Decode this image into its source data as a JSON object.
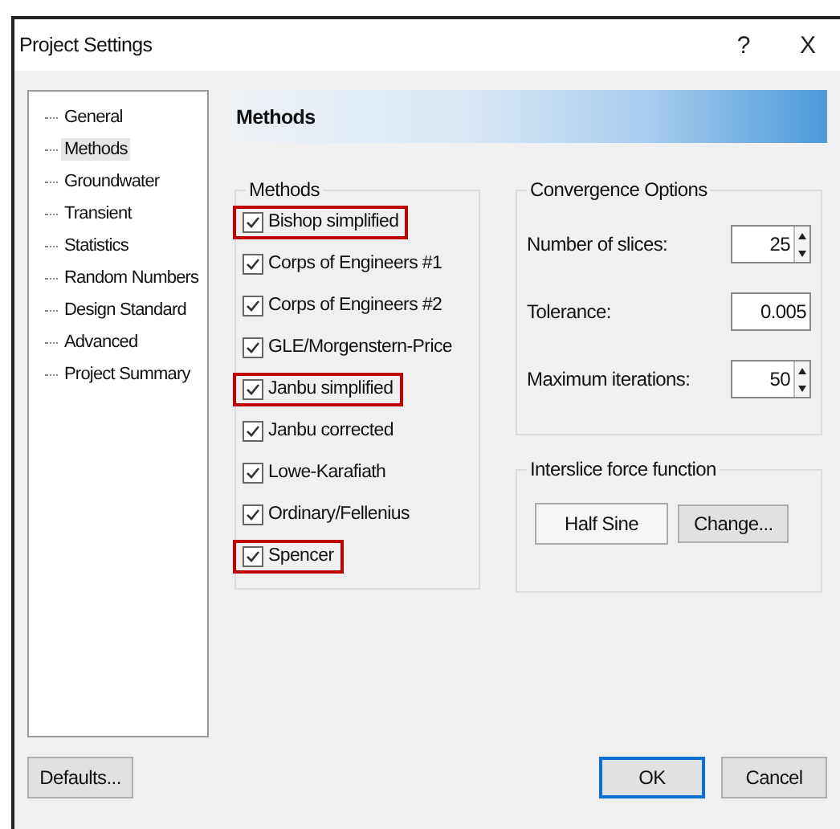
{
  "window": {
    "title": "Project Settings",
    "help": "?",
    "close": "X"
  },
  "sidebar": {
    "items": [
      {
        "label": "General",
        "selected": false
      },
      {
        "label": "Methods",
        "selected": true
      },
      {
        "label": "Groundwater",
        "selected": false
      },
      {
        "label": "Transient",
        "selected": false
      },
      {
        "label": "Statistics",
        "selected": false
      },
      {
        "label": "Random Numbers",
        "selected": false
      },
      {
        "label": "Design Standard",
        "selected": false
      },
      {
        "label": "Advanced",
        "selected": false
      },
      {
        "label": "Project Summary",
        "selected": false
      }
    ]
  },
  "header": {
    "title": "Methods"
  },
  "methods": {
    "title": "Methods",
    "items": [
      {
        "label": "Bishop simplified",
        "checked": true,
        "highlighted": true
      },
      {
        "label": "Corps of Engineers #1",
        "checked": true,
        "highlighted": false
      },
      {
        "label": "Corps of Engineers #2",
        "checked": true,
        "highlighted": false
      },
      {
        "label": "GLE/Morgenstern-Price",
        "checked": true,
        "highlighted": false
      },
      {
        "label": "Janbu simplified",
        "checked": true,
        "highlighted": true
      },
      {
        "label": "Janbu corrected",
        "checked": true,
        "highlighted": false
      },
      {
        "label": "Lowe-Karafiath",
        "checked": true,
        "highlighted": false
      },
      {
        "label": "Ordinary/Fellenius",
        "checked": true,
        "highlighted": false
      },
      {
        "label": "Spencer",
        "checked": true,
        "highlighted": true
      }
    ]
  },
  "convergence": {
    "title": "Convergence Options",
    "fields": [
      {
        "label": "Number of slices:",
        "value": "25",
        "kind": "spinner"
      },
      {
        "label": "Tolerance:",
        "value": "0.005",
        "kind": "text"
      },
      {
        "label": "Maximum iterations:",
        "value": "50",
        "kind": "spinner"
      }
    ]
  },
  "interslice": {
    "title": "Interslice force function",
    "value": "Half Sine",
    "button": "Change..."
  },
  "buttons": {
    "defaults": "Defaults...",
    "ok": "OK",
    "cancel": "Cancel"
  }
}
